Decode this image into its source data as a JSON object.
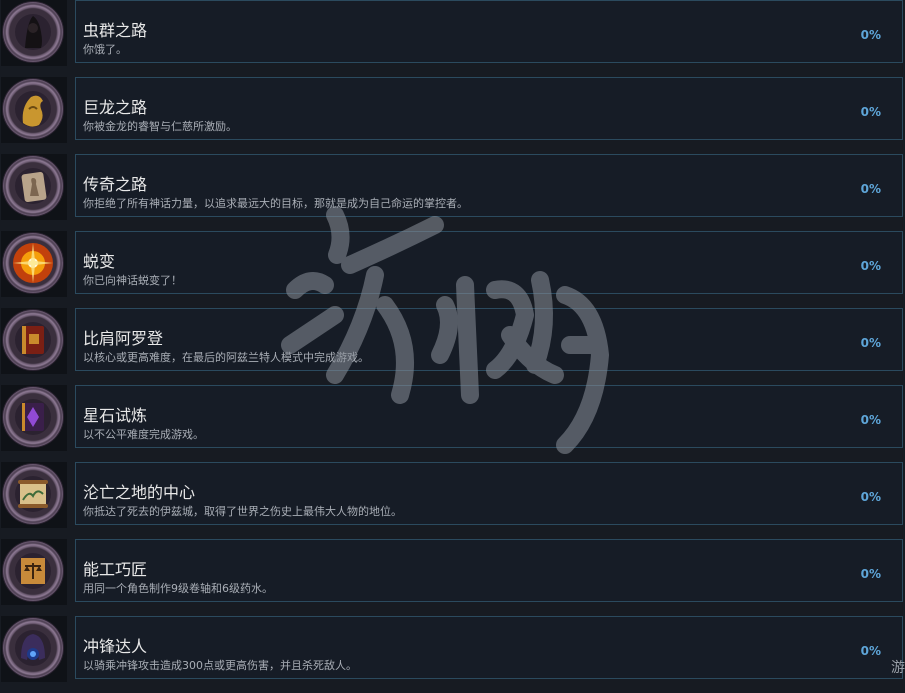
{
  "achievements": [
    {
      "title": "虫群之路",
      "desc": "你饿了。",
      "percent": "0%",
      "icon": "swarm-icon"
    },
    {
      "title": "巨龙之路",
      "desc": "你被金龙的睿智与仁慈所激励。",
      "percent": "0%",
      "icon": "dragon-icon"
    },
    {
      "title": "传奇之路",
      "desc": "你拒绝了所有神话力量，以追求最远大的目标，那就是成为自己命运的掌控者。",
      "percent": "0%",
      "icon": "legend-icon"
    },
    {
      "title": "蜕变",
      "desc": "你已向神话蜕变了！",
      "percent": "0%",
      "icon": "burst-icon"
    },
    {
      "title": "比肩阿罗登",
      "desc": "以核心或更高难度，在最后的阿兹兰特人模式中完成游戏。",
      "percent": "0%",
      "icon": "book-icon"
    },
    {
      "title": "星石试炼",
      "desc": "以不公平难度完成游戏。",
      "percent": "0%",
      "icon": "tome-icon"
    },
    {
      "title": "沦亡之地的中心",
      "desc": "你抵达了死去的伊兹城，取得了世界之伤史上最伟大人物的地位。",
      "percent": "0%",
      "icon": "scroll-icon"
    },
    {
      "title": "能工巧匠",
      "desc": "用同一个角色制作9级卷轴和6级药水。",
      "percent": "0%",
      "icon": "scales-icon"
    },
    {
      "title": "冲锋达人",
      "desc": "以骑乘冲锋攻击造成300点或更高伤害，并且杀死敌人。",
      "percent": "0%",
      "icon": "helmet-icon"
    }
  ],
  "watermark": {
    "text": "游侠网"
  },
  "corner_glyph": "游"
}
